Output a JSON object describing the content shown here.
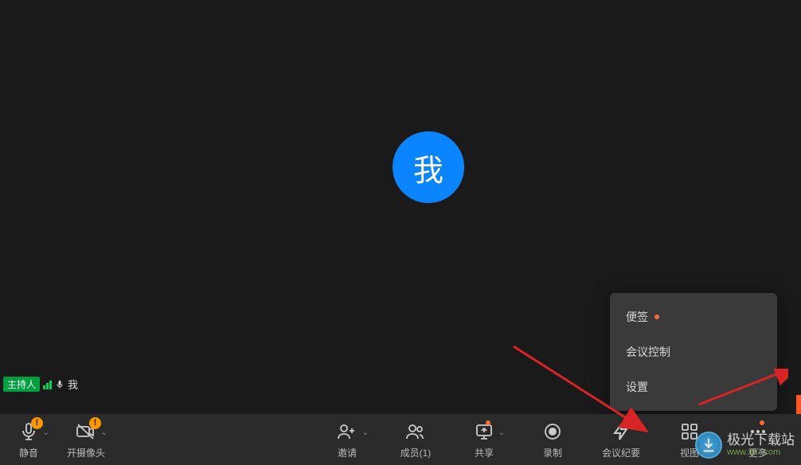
{
  "avatar": {
    "text": "我"
  },
  "user_badge": {
    "host_tag": "主持人",
    "me_label": "我"
  },
  "toolbar": {
    "mute": {
      "label": "静音"
    },
    "camera": {
      "label": "开摄像头"
    },
    "invite": {
      "label": "邀请"
    },
    "members": {
      "label": "成员(1)"
    },
    "share": {
      "label": "共享"
    },
    "record": {
      "label": "录制"
    },
    "minutes": {
      "label": "会议纪要"
    },
    "view": {
      "label": "视图"
    },
    "more": {
      "label": "更多"
    }
  },
  "menu": {
    "notes": "便签",
    "control": "会议控制",
    "settings": "设置"
  },
  "watermark": {
    "cn": "极光下载站",
    "en": "www.xz7.com"
  }
}
